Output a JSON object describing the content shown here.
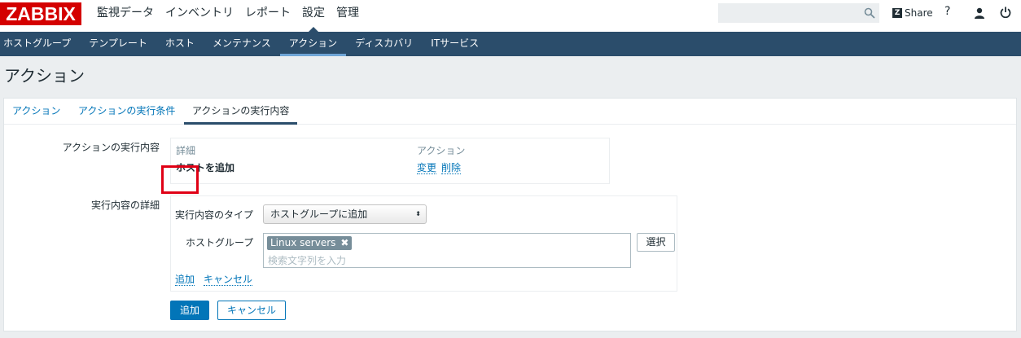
{
  "brand": {
    "logo": "ZABBIX",
    "color": "#d40000"
  },
  "main_nav": [
    {
      "label": "監視データ",
      "active": false
    },
    {
      "label": "インベントリ",
      "active": false
    },
    {
      "label": "レポート",
      "active": false
    },
    {
      "label": "設定",
      "active": true
    },
    {
      "label": "管理",
      "active": false
    }
  ],
  "header": {
    "search_placeholder": "",
    "share_label": "Share",
    "help_label": "?"
  },
  "sub_nav": [
    {
      "label": "ホストグループ",
      "active": false
    },
    {
      "label": "テンプレート",
      "active": false
    },
    {
      "label": "ホスト",
      "active": false
    },
    {
      "label": "メンテナンス",
      "active": false
    },
    {
      "label": "アクション",
      "active": true
    },
    {
      "label": "ディスカバリ",
      "active": false
    },
    {
      "label": "ITサービス",
      "active": false
    }
  ],
  "page_title": "アクション",
  "tabs": [
    {
      "label": "アクション",
      "active": false
    },
    {
      "label": "アクションの実行条件",
      "active": false
    },
    {
      "label": "アクションの実行内容",
      "active": true
    }
  ],
  "operations": {
    "label": "アクションの実行内容",
    "col_details": "詳細",
    "col_action": "アクション",
    "row_detail": "ホストを追加",
    "edit_link": "変更",
    "delete_link": "削除"
  },
  "operation_details": {
    "label": "実行内容の詳細",
    "type_label": "実行内容のタイプ",
    "type_value": "ホストグループに追加",
    "hostgroup_label": "ホストグループ",
    "chip_value": "Linux servers",
    "search_placeholder": "検索文字列を入力",
    "select_button": "選択",
    "add_link": "追加",
    "cancel_link": "キャンセル"
  },
  "form_buttons": {
    "add": "追加",
    "cancel": "キャンセル"
  },
  "colors": {
    "nav_dark": "#2b4d6b",
    "link": "#0275b8",
    "highlight": "#e00015"
  }
}
